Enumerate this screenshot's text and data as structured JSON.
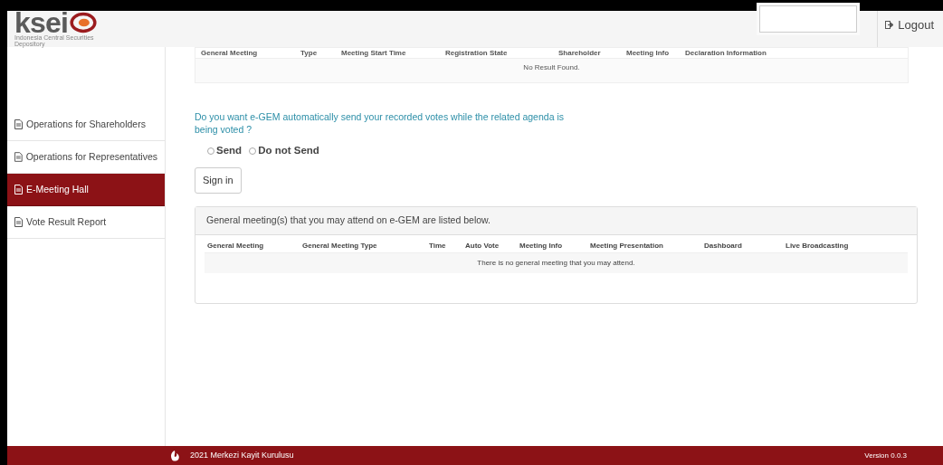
{
  "header": {
    "logo_text": "ksei",
    "logo_tagline": "Indonesia Central Securities Depository",
    "logout": "Logout"
  },
  "sidebar": {
    "items": [
      {
        "label": "Operations for Shareholders",
        "selected": false
      },
      {
        "label": "Operations for Representatives",
        "selected": false
      },
      {
        "label": "E-Meeting Hall",
        "selected": true
      },
      {
        "label": "Vote Result Report",
        "selected": false
      }
    ]
  },
  "registrations_table": {
    "columns": [
      "General Meeting",
      "Type",
      "Meeting Start Time",
      "Registration State",
      "Shareholder",
      "Meeting Info",
      "Declaration Information"
    ],
    "empty_message": "No Result Found."
  },
  "auto_vote": {
    "question": "Do you want e-GEM automatically send your recorded votes while the related agenda is being voted ?",
    "options": [
      {
        "label": "Send",
        "selected": false
      },
      {
        "label": "Do not Send",
        "selected": false
      }
    ],
    "button": "Sign in"
  },
  "meetings_panel": {
    "title": "General meeting(s) that you may attend on e-GEM are listed below.",
    "columns": [
      "General Meeting",
      "General Meeting Type",
      "Time",
      "Auto Vote",
      "Meeting Info",
      "Meeting Presentation",
      "Dashboard",
      "Live Broadcasting"
    ],
    "empty_message": "There is no general meeting that you may attend."
  },
  "footer": {
    "copyright": "2021 Merkezi Kayit Kurulusu",
    "version": "Version 0.0.3"
  }
}
